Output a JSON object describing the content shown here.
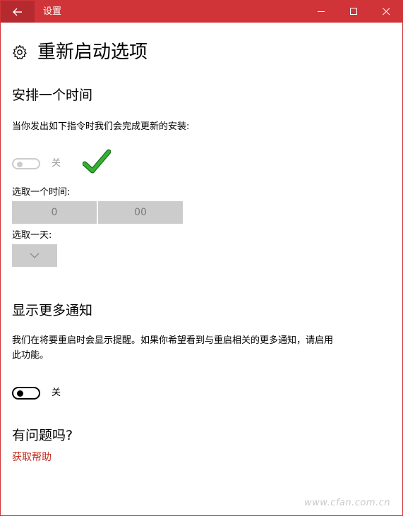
{
  "titlebar": {
    "title": "设置",
    "back_icon": "arrow-left-icon",
    "minimize_icon": "minimize-icon",
    "maximize_icon": "maximize-icon",
    "close_icon": "close-icon",
    "color": "#d13438"
  },
  "page": {
    "title": "重新启动选项",
    "icon": "gear-icon"
  },
  "schedule": {
    "heading": "安排一个时间",
    "description": "当你发出如下指令时我们会完成更新的安装:",
    "toggle_label": "关",
    "toggle_state": "off-disabled",
    "pick_time_label": "选取一个时间:",
    "hour_value": "0",
    "minute_value": "00",
    "pick_day_label": "选取一天:",
    "day_value": ""
  },
  "notifications": {
    "heading": "显示更多通知",
    "description_line1": "我们在将要重启时会显示提醒。如果你希望看到与重启相关的更多通知，请启用",
    "description_line2": "此功能。",
    "toggle_label": "关",
    "toggle_state": "off"
  },
  "help": {
    "heading": "有问题吗?",
    "link_label": "获取帮助",
    "link_color": "#c42b1c"
  },
  "annotation": {
    "icon": "green-checkmark-icon",
    "color": "#2ea02e"
  },
  "watermark": {
    "text": "www.cfan.com.cn"
  }
}
